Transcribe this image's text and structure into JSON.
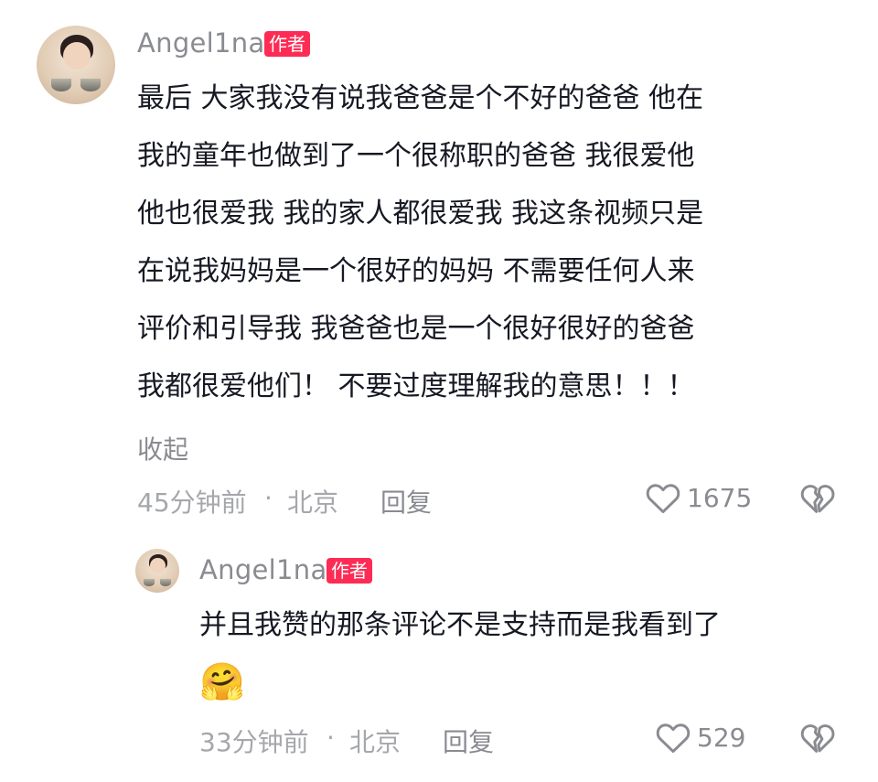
{
  "comment": {
    "username": "Angel1na",
    "author_tag": "作者",
    "lines": [
      "最后 大家我没有说我爸爸是个不好的爸爸 他在",
      "我的童年也做到了一个很称职的爸爸 我很爱他",
      "他也很爱我 我的家人都很爱我 我这条视频只是",
      "在说我妈妈是一个很好的妈妈 不需要任何人来",
      "评价和引导我 我爸爸也是一个很好很好的爸爸",
      "我都很爱他们！ 不要过度理解我的意思！！！"
    ],
    "collapse_label": "收起",
    "time": "45分钟前",
    "separator": "·",
    "location": "北京",
    "reply_label": "回复",
    "like_count": "1675"
  },
  "reply": {
    "username": "Angel1na",
    "author_tag": "作者",
    "text": "并且我赞的那条评论不是支持而是我看到了",
    "emoji": "🤗",
    "time": "33分钟前",
    "separator": "·",
    "location": "北京",
    "reply_label": "回复",
    "like_count": "529"
  },
  "icons": {
    "like": "heart-outline-icon",
    "dislike": "broken-heart-icon"
  },
  "colors": {
    "author_tag_bg": "#fe2c55",
    "text": "#161823",
    "muted": "#8a8b91"
  }
}
